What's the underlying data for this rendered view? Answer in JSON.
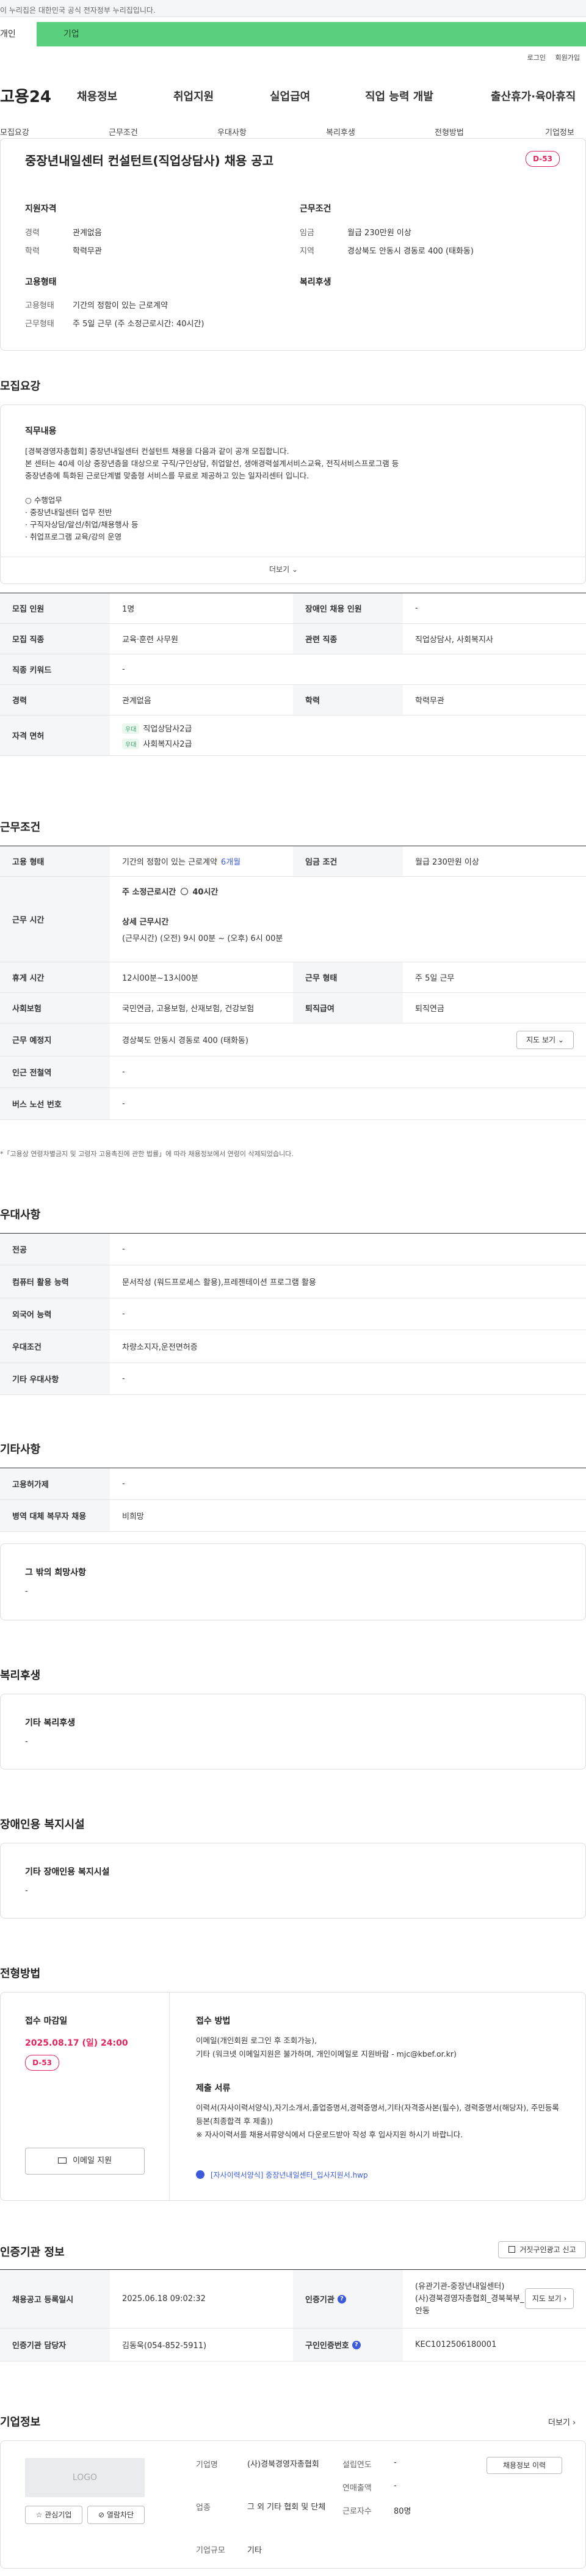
{
  "topbar": {
    "notice": "이 누리집은 대한민국 공식 전자정부 누리집입니다."
  },
  "user_tabs": {
    "personal": "개인",
    "corporate": "기업"
  },
  "top_links": {
    "login": "로그인",
    "signup": "회원가입"
  },
  "site": {
    "logo": "고용24"
  },
  "gnb": {
    "items": [
      "채용정보",
      "취업지원",
      "실업급여",
      "직업 능력 개발",
      "출산휴가·육아휴직"
    ]
  },
  "subnav": {
    "items": [
      "모집요강",
      "근무조건",
      "우대사항",
      "복리후생",
      "전형방법",
      "기업정보"
    ]
  },
  "job": {
    "title": "중장년내일센터 컨설턴트(직업상담사) 채용 공고",
    "dday": "D-53",
    "qualification": {
      "heading": "지원자격",
      "career_label": "경력",
      "career_value": "관계없음",
      "edu_label": "학력",
      "edu_value": "학력무관"
    },
    "conditions": {
      "heading": "근무조건",
      "wage_label": "임금",
      "wage_value": "월급 230만원 이상",
      "region_label": "지역",
      "region_value": "경상북도 안동시 경동로 400 (태화동)"
    },
    "employment": {
      "heading": "고용형태",
      "type_label": "고용형태",
      "type_value": "기간의 정함이 있는 근로계약",
      "hours_label": "근무형태",
      "hours_value": "주 5일 근무 (주 소정근로시간: 40시간)"
    },
    "welfare": {
      "heading": "복리후생"
    }
  },
  "recruit": {
    "heading": "모집요강",
    "duty_heading": "직무내용",
    "duty_lines": [
      "[경북경영자총협회] 중장년내일센터 컨설턴트 채용을 다음과 같이 공개 모집합니다.",
      "본 센터는 40세 이상 중장년층을 대상으로 구직/구인상담, 취업알선, 생애경력설계서비스교육, 전직서비스프로그램 등",
      "중장년층에 특화된 근로단계별 맞춤형 서비스를 무료로 제공하고 있는 일자리센터 입니다.",
      "",
      "○ 수행업무",
      "· 중장년내일센터 업무 전반",
      "· 구직자상담/알선/취업/채용행사 등",
      "· 취업프로그램 교육/강의 운영"
    ],
    "more": "더보기",
    "table": {
      "headcount_label": "모집 인원",
      "headcount_value": "1명",
      "disabled_label": "장애인 채용 인원",
      "disabled_value": "-",
      "job_label": "모집 직종",
      "job_value": "교육·훈련 사무원",
      "related_label": "관련 직종",
      "related_value": "직업상담사, 사회복지사",
      "keyword_label": "직종 키워드",
      "keyword_value": "-",
      "career_label": "경력",
      "career_value": "관계없음",
      "edu_label": "학력",
      "edu_value": "학력무관",
      "license_label": "자격 면허",
      "license_items": [
        {
          "tag": "우대",
          "name": "직업상담사2급"
        },
        {
          "tag": "우대",
          "name": "사회복지사2급"
        }
      ]
    }
  },
  "work": {
    "heading": "근무조건",
    "type_label": "고용 형태",
    "type_value": "기간의 정함이 있는 근로계약",
    "type_period": "6개월",
    "wage_label": "임금 조건",
    "wage_value": "월급 230만원 이상",
    "time_label": "근무 시간",
    "time_weekly": "주 소정근로시간",
    "time_weekly_value": "40시간",
    "time_detail_heading": "상세 근무시간",
    "time_detail_value": "(근무시간) (오전) 9시 00분 ~ (오후) 6시 00분",
    "break_label": "휴게 시간",
    "break_value": "12시00분~13시00분",
    "shift_label": "근무 형태",
    "shift_value": "주 5일 근무",
    "insurance_label": "사회보험",
    "insurance_value": "국민연금, 고용보험, 산재보험, 건강보험",
    "severance_label": "퇴직급여",
    "severance_value": "퇴직연금",
    "place_label": "근무 예정지",
    "place_value": "경상북도 안동시 경동로 400 (태화동)",
    "map_button": "지도 보기",
    "subway_label": "인근 전철역",
    "subway_value": "-",
    "bus_label": "버스 노선 번호",
    "bus_value": "-",
    "note": "*「고용상 연령차별금지 및 고령자 고용촉진에 관한 법률」에 따라 채용정보에서 연령이 삭제되었습니다."
  },
  "pref": {
    "heading": "우대사항",
    "major_label": "전공",
    "major_value": "-",
    "computer_label": "컴퓨터 활용 능력",
    "computer_value": "문서작성 (워드프로세스 활용),프레젠테이션 프로그램 활용",
    "language_label": "외국어 능력",
    "language_value": "-",
    "condition_label": "우대조건",
    "condition_value": "차량소지자,운전면허증",
    "other_label": "기타 우대사항",
    "other_value": "-"
  },
  "etc": {
    "heading": "기타사항",
    "equip_label": "고용허가제",
    "equip_value": "-",
    "military_label": "병역 대체 복무자 채용",
    "military_value": "비희망",
    "other_heading": "그 밖의 희망사항",
    "other_value": "-"
  },
  "benefit": {
    "heading": "복리후생",
    "box_heading": "기타 복리후생",
    "box_value": "-"
  },
  "facility": {
    "heading": "장애인용 복지시설",
    "box_heading": "기타 장애인용 복지시설",
    "box_value": "-"
  },
  "selection": {
    "heading": "전형방법",
    "deadline_heading": "접수 마감일",
    "deadline_value": "2025.08.17 (일) 24:00",
    "dday": "D-53",
    "email_button": "이메일 지원",
    "method_heading": "접수 방법",
    "method_lines": [
      "이메일(개인회원 로그인 후 조회가능),",
      "기타 (워크넷 이메일지원은 불가하며, 개인이메일로  지원바람 - mjc@kbef.or.kr)"
    ],
    "docs_heading": "제출 서류",
    "docs_lines": [
      "이력서(자사이력서양식),자기소개서,졸업증명서,경력증명서,기타(자격증사본(필수), 경력증명서(해당자), 주민등록등본(최종합격 후 제출))",
      "※ 자사이력서를 채용서류양식에서 다운로드받아 작성 후 입사지원 하시기 바랍니다."
    ],
    "attachment": "[자사이력서양식] 중장년내일센터_입사지원서.hwp"
  },
  "agency": {
    "heading": "인증기관 정보",
    "report_button": "거짓구인광고 신고",
    "reg_label": "채용공고 등록일시",
    "reg_value": "2025.06.18 09:02:32",
    "org_label": "인증기관",
    "org_lines": [
      "(유관기관-중장년내일센터)",
      "(사)경북경영자총협회_경북북부_안동"
    ],
    "map_button": "지도 보기",
    "manager_label": "인증기관 담당자",
    "manager_value": "김동욱(054-852-5911)",
    "cert_label": "구인인증번호",
    "cert_value": "KEC1012506180001"
  },
  "company": {
    "heading": "기업정보",
    "more": "더보기",
    "logo_text": "LOGO",
    "fav_button": "관심기업",
    "block_button": "열람차단",
    "name_label": "기업명",
    "name_value": "(사)경북경영자총협회",
    "industry_label": "업종",
    "industry_value": "그 외 기타 협회 및 단체",
    "size_label": "기업규모",
    "size_value": "기타",
    "founded_label": "설립연도",
    "founded_value": "-",
    "revenue_label": "연매출액",
    "revenue_value": "-",
    "employees_label": "근로자수",
    "employees_value": "80명",
    "history_button": "채용정보 이력"
  }
}
